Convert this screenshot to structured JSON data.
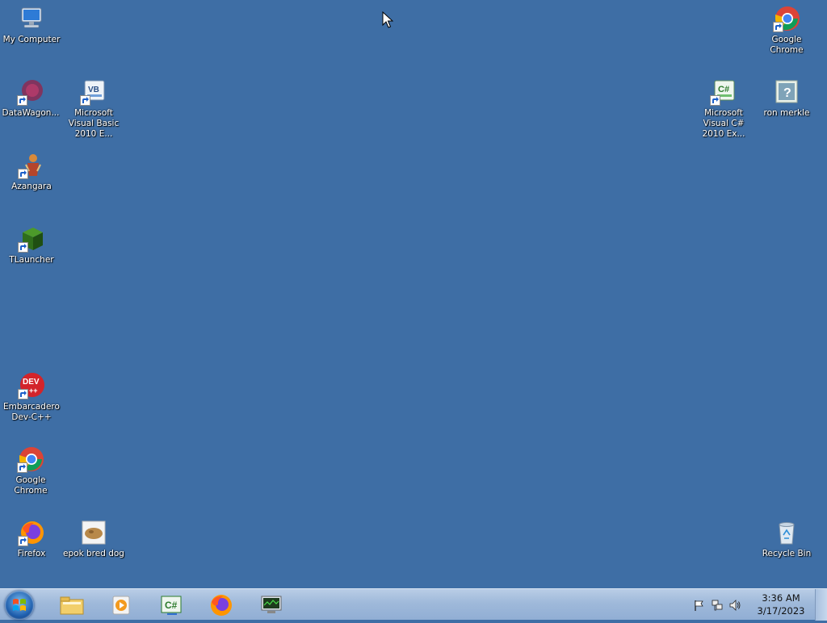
{
  "desktop": {
    "icons": {
      "my_computer": "My Computer",
      "google_chrome_top": "Google Chrome",
      "datawagon": "DataWagon...",
      "vb2010": "Microsoft Visual Basic 2010 E...",
      "csharp2010": "Microsoft Visual C# 2010 Ex...",
      "ron_merkle": "ron merkle",
      "azangara": "Azangara",
      "tlauncher": "TLauncher",
      "devcpp": "Embarcadero Dev-C++",
      "google_chrome": "Google Chrome",
      "firefox": "Firefox",
      "epok_bred_dog": "epok bred dog",
      "recycle_bin": "Recycle Bin"
    }
  },
  "taskbar": {
    "pinned": [
      "file-explorer-icon",
      "media-player-icon",
      "visual-csharp-icon",
      "firefox-icon",
      "network-monitor-icon"
    ],
    "tray": {
      "icons": [
        "action-center-flag-icon",
        "network-icon",
        "volume-icon"
      ],
      "time": "3:36 AM",
      "date": "3/17/2023"
    }
  },
  "colors": {
    "desktop_background": "#3e6ea5",
    "taskbar": "#a9c1df"
  }
}
